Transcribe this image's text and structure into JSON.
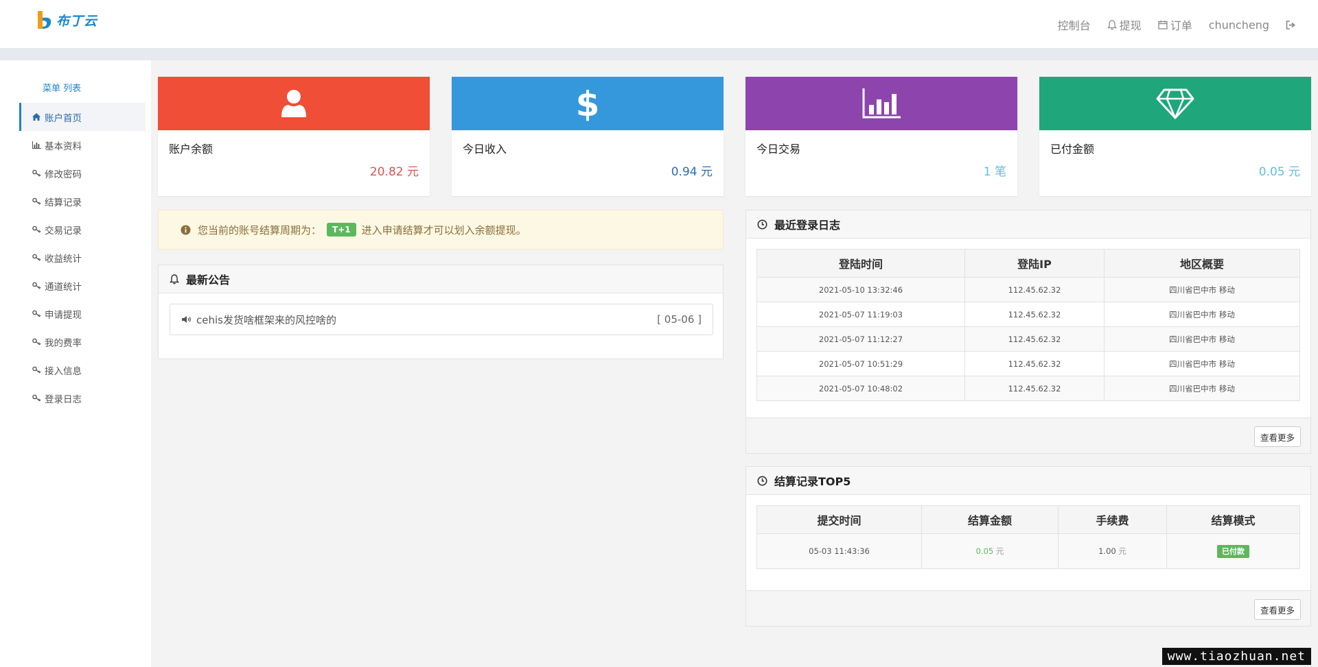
{
  "brand": {
    "name": "布丁云"
  },
  "topnav": {
    "console": "控制台",
    "withdraw": "提现",
    "orders": "订单",
    "username": "chuncheng"
  },
  "sidebar": {
    "title": "菜单 列表",
    "items": [
      {
        "label": "账户首页",
        "icon": "home-icon"
      },
      {
        "label": "基本资料",
        "icon": "bar-chart-icon"
      },
      {
        "label": "修改密码",
        "icon": "key-icon"
      },
      {
        "label": "结算记录",
        "icon": "key-icon"
      },
      {
        "label": "交易记录",
        "icon": "key-icon"
      },
      {
        "label": "收益统计",
        "icon": "key-icon"
      },
      {
        "label": "通道统计",
        "icon": "key-icon"
      },
      {
        "label": "申请提现",
        "icon": "key-icon"
      },
      {
        "label": "我的费率",
        "icon": "key-icon"
      },
      {
        "label": "接入信息",
        "icon": "key-icon"
      },
      {
        "label": "登录日志",
        "icon": "key-icon"
      }
    ]
  },
  "cards": [
    {
      "label": "账户余额",
      "value": "20.82 元",
      "color": "#f04e37",
      "value_color": "#d9534f",
      "icon": "user-icon"
    },
    {
      "label": "今日收入",
      "value": "0.94 元",
      "color": "#3598dc",
      "value_color": "#2a6fb0",
      "icon": "dollar-icon"
    },
    {
      "label": "今日交易",
      "value": "1 笔",
      "color": "#8e44ad",
      "value_color": "#5bc0de",
      "icon": "bar-chart-icon"
    },
    {
      "label": "已付金额",
      "value": "0.05 元",
      "color": "#1fa67a",
      "value_color": "#5bc0de",
      "icon": "diamond-icon"
    }
  ],
  "notice": {
    "prefix": "您当前的账号结算周期为：",
    "badge": "T+1",
    "suffix": "进入申请结算才可以划入余额提现。"
  },
  "announcements": {
    "title": "最新公告",
    "items": [
      {
        "text": "cehis发货啥框架来的风控啥的",
        "date": "[ 05-06 ]"
      }
    ]
  },
  "login_log": {
    "title": "最近登录日志",
    "headers": [
      "登陆时间",
      "登陆IP",
      "地区概要"
    ],
    "rows": [
      [
        "2021-05-10 13:32:46",
        "112.45.62.32",
        "四川省巴中市 移动"
      ],
      [
        "2021-05-07 11:19:03",
        "112.45.62.32",
        "四川省巴中市 移动"
      ],
      [
        "2021-05-07 11:12:27",
        "112.45.62.32",
        "四川省巴中市 移动"
      ],
      [
        "2021-05-07 10:51:29",
        "112.45.62.32",
        "四川省巴中市 移动"
      ],
      [
        "2021-05-07 10:48:02",
        "112.45.62.32",
        "四川省巴中市 移动"
      ]
    ],
    "more": "查看更多"
  },
  "settlements": {
    "title": "结算记录TOP5",
    "headers": [
      "提交时间",
      "结算金额",
      "手续费",
      "结算模式"
    ],
    "rows": [
      {
        "time": "05-03 11:43:36",
        "amount": "0.05",
        "amount_unit": "元",
        "fee": "1.00",
        "fee_unit": "元",
        "mode": "已付款"
      }
    ],
    "more": "查看更多"
  },
  "watermark": "www.tiaozhuan.net"
}
